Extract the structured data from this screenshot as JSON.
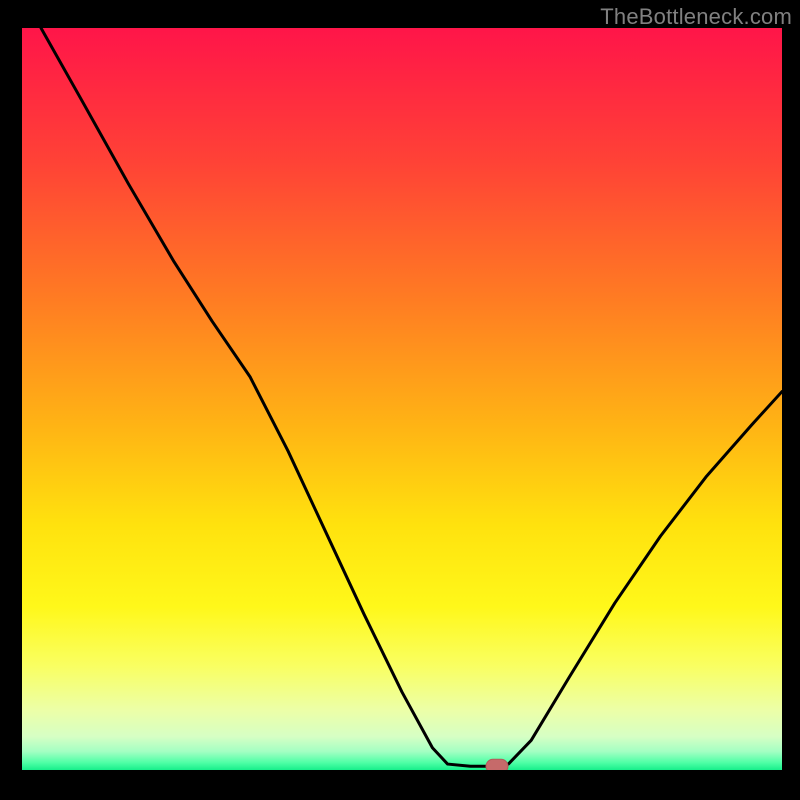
{
  "watermark": "TheBottleneck.com",
  "colors": {
    "background": "#000000",
    "curve": "#000000",
    "marker_fill": "#c66a6a",
    "marker_stroke": "#b45a5a",
    "gradient_stops": [
      {
        "offset": 0.0,
        "color": "#ff1549"
      },
      {
        "offset": 0.18,
        "color": "#ff4236"
      },
      {
        "offset": 0.36,
        "color": "#ff7a23"
      },
      {
        "offset": 0.54,
        "color": "#ffb514"
      },
      {
        "offset": 0.67,
        "color": "#ffe20e"
      },
      {
        "offset": 0.78,
        "color": "#fff81a"
      },
      {
        "offset": 0.86,
        "color": "#f9ff62"
      },
      {
        "offset": 0.92,
        "color": "#ecffa8"
      },
      {
        "offset": 0.955,
        "color": "#d6ffc4"
      },
      {
        "offset": 0.975,
        "color": "#a4ffc3"
      },
      {
        "offset": 0.99,
        "color": "#4fffa6"
      },
      {
        "offset": 1.0,
        "color": "#17ef8b"
      }
    ]
  },
  "chart_data": {
    "type": "line",
    "title": "",
    "xlabel": "",
    "ylabel": "",
    "xlim": [
      0,
      100
    ],
    "ylim": [
      0,
      100
    ],
    "curve": [
      {
        "x": 2.5,
        "y": 100.0
      },
      {
        "x": 8.0,
        "y": 90.0
      },
      {
        "x": 14.0,
        "y": 79.0
      },
      {
        "x": 20.0,
        "y": 68.5
      },
      {
        "x": 25.0,
        "y": 60.5
      },
      {
        "x": 30.0,
        "y": 53.0
      },
      {
        "x": 35.0,
        "y": 43.0
      },
      {
        "x": 40.0,
        "y": 32.0
      },
      {
        "x": 45.0,
        "y": 21.0
      },
      {
        "x": 50.0,
        "y": 10.5
      },
      {
        "x": 54.0,
        "y": 3.0
      },
      {
        "x": 56.0,
        "y": 0.8
      },
      {
        "x": 59.0,
        "y": 0.5
      },
      {
        "x": 62.0,
        "y": 0.5
      },
      {
        "x": 64.0,
        "y": 0.8
      },
      {
        "x": 67.0,
        "y": 4.0
      },
      {
        "x": 72.0,
        "y": 12.5
      },
      {
        "x": 78.0,
        "y": 22.5
      },
      {
        "x": 84.0,
        "y": 31.5
      },
      {
        "x": 90.0,
        "y": 39.5
      },
      {
        "x": 96.0,
        "y": 46.5
      },
      {
        "x": 100.0,
        "y": 51.0
      }
    ],
    "marker": {
      "x": 62.5,
      "y": 0.5
    }
  }
}
